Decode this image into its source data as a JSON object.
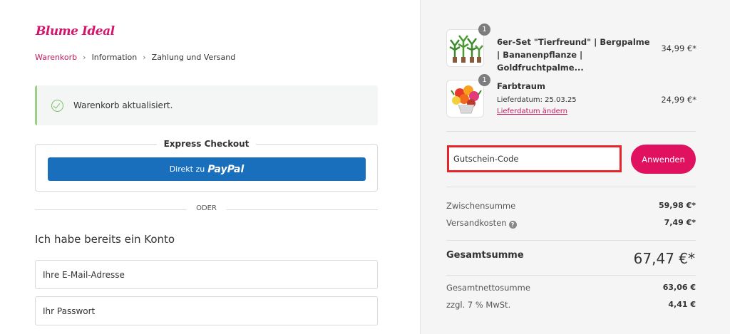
{
  "brand": {
    "logo_text": "Blume Ideal",
    "accent": "#d4146d"
  },
  "breadcrumb": {
    "items": [
      "Warenkorb",
      "Information",
      "Zahlung und Versand"
    ]
  },
  "alert": {
    "message": "Warenkorb aktualisiert."
  },
  "express": {
    "title": "Express Checkout",
    "paypal_prefix": "Direkt zu",
    "paypal_logo": "PayPal"
  },
  "divider_text": "ODER",
  "login": {
    "title": "Ich habe bereits ein Konto",
    "email_placeholder": "Ihre E-Mail-Adresse",
    "password_placeholder": "Ihr Passwort"
  },
  "cart": {
    "items": [
      {
        "qty": "1",
        "name": "6er-Set \"Tierfreund\" | Bergpalme | Bananenpflanze | Goldfruchtpalme...",
        "price": "34,99 €*"
      },
      {
        "qty": "1",
        "name": "Farbtraum",
        "delivery": "Lieferdatum: 25.03.25",
        "change_link": "Lieferdatum ändern",
        "price": "24,99 €*"
      }
    ]
  },
  "coupon": {
    "placeholder": "Gutschein-Code",
    "apply_label": "Anwenden"
  },
  "summary": {
    "subtotal_label": "Zwischensumme",
    "subtotal_value": "59,98 €*",
    "shipping_label": "Versandkosten",
    "shipping_value": "7,49 €*",
    "total_label": "Gesamtsumme",
    "total_value": "67,47 €*",
    "net_label": "Gesamtnettosumme",
    "net_value": "63,06 €",
    "tax_label": "zzgl. 7 % MwSt.",
    "tax_value": "4,41 €"
  }
}
